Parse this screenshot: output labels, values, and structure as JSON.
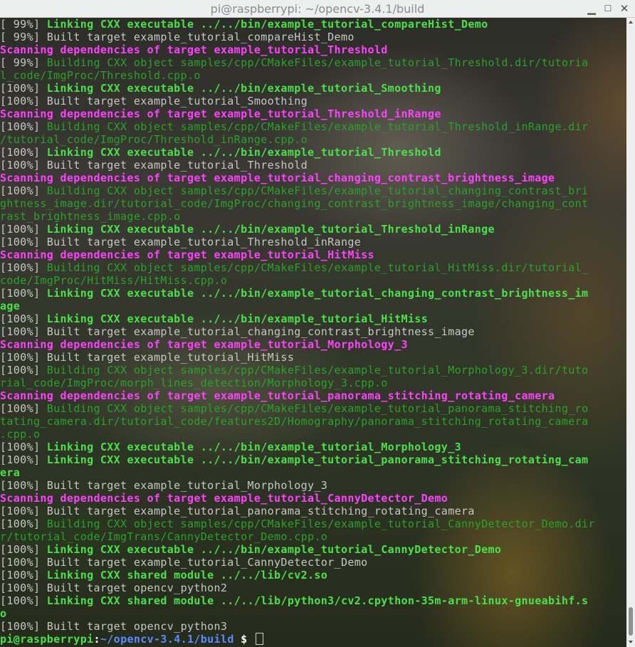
{
  "window": {
    "title": "pi@raspberrypi: ~/opencv-3.4.1/build",
    "minimize_glyph": "▁",
    "maximize_glyph": "☐",
    "close_glyph": "✕"
  },
  "colors": {
    "link_green": "#49e349",
    "build_green": "#27a427",
    "scan_magenta": "#ff40ff",
    "text_grey": "#c7c7c7",
    "prompt_path_blue": "#5a8cff"
  },
  "terminal": {
    "lines": [
      [
        {
          "c": "pct",
          "t": "[ 99%] "
        },
        {
          "c": "green",
          "t": "Linking CXX executable ../../bin/example_tutorial_compareHist_Demo"
        }
      ],
      [
        {
          "c": "pct",
          "t": "[ 99%] "
        },
        {
          "c": "grey",
          "t": "Built target example_tutorial_compareHist_Demo"
        }
      ],
      [
        {
          "c": "magenta",
          "t": "Scanning dependencies of target example_tutorial_Threshold"
        }
      ],
      [
        {
          "c": "pct",
          "t": "[ 99%] "
        },
        {
          "c": "dkgreen",
          "t": "Building CXX object samples/cpp/CMakeFiles/example_tutorial_Threshold.dir/tutoria"
        }
      ],
      [
        {
          "c": "dkgreen",
          "t": "l_code/ImgProc/Threshold.cpp.o"
        }
      ],
      [
        {
          "c": "pct",
          "t": "[100%] "
        },
        {
          "c": "green",
          "t": "Linking CXX executable ../../bin/example_tutorial_Smoothing"
        }
      ],
      [
        {
          "c": "pct",
          "t": "[100%] "
        },
        {
          "c": "grey",
          "t": "Built target example_tutorial_Smoothing"
        }
      ],
      [
        {
          "c": "magenta",
          "t": "Scanning dependencies of target example_tutorial_Threshold_inRange"
        }
      ],
      [
        {
          "c": "pct",
          "t": "[100%] "
        },
        {
          "c": "dkgreen",
          "t": "Building CXX object samples/cpp/CMakeFiles/example_tutorial_Threshold_inRange.dir"
        }
      ],
      [
        {
          "c": "dkgreen",
          "t": "/tutorial_code/ImgProc/Threshold_inRange.cpp.o"
        }
      ],
      [
        {
          "c": "pct",
          "t": "[100%] "
        },
        {
          "c": "green",
          "t": "Linking CXX executable ../../bin/example_tutorial_Threshold"
        }
      ],
      [
        {
          "c": "pct",
          "t": "[100%] "
        },
        {
          "c": "grey",
          "t": "Built target example_tutorial_Threshold"
        }
      ],
      [
        {
          "c": "magenta",
          "t": "Scanning dependencies of target example_tutorial_changing_contrast_brightness_image"
        }
      ],
      [
        {
          "c": "pct",
          "t": "[100%] "
        },
        {
          "c": "dkgreen",
          "t": "Building CXX object samples/cpp/CMakeFiles/example_tutorial_changing_contrast_bri"
        }
      ],
      [
        {
          "c": "dkgreen",
          "t": "ghtness_image.dir/tutorial_code/ImgProc/changing_contrast_brightness_image/changing_cont"
        }
      ],
      [
        {
          "c": "dkgreen",
          "t": "rast_brightness_image.cpp.o"
        }
      ],
      [
        {
          "c": "pct",
          "t": "[100%] "
        },
        {
          "c": "green",
          "t": "Linking CXX executable ../../bin/example_tutorial_Threshold_inRange"
        }
      ],
      [
        {
          "c": "pct",
          "t": "[100%] "
        },
        {
          "c": "grey",
          "t": "Built target example_tutorial_Threshold_inRange"
        }
      ],
      [
        {
          "c": "magenta",
          "t": "Scanning dependencies of target example_tutorial_HitMiss"
        }
      ],
      [
        {
          "c": "pct",
          "t": "[100%] "
        },
        {
          "c": "dkgreen",
          "t": "Building CXX object samples/cpp/CMakeFiles/example_tutorial_HitMiss.dir/tutorial_"
        }
      ],
      [
        {
          "c": "dkgreen",
          "t": "code/ImgProc/HitMiss/HitMiss.cpp.o"
        }
      ],
      [
        {
          "c": "pct",
          "t": "[100%] "
        },
        {
          "c": "green",
          "t": "Linking CXX executable ../../bin/example_tutorial_changing_contrast_brightness_im"
        }
      ],
      [
        {
          "c": "green",
          "t": "age"
        }
      ],
      [
        {
          "c": "pct",
          "t": "[100%] "
        },
        {
          "c": "green",
          "t": "Linking CXX executable ../../bin/example_tutorial_HitMiss"
        }
      ],
      [
        {
          "c": "pct",
          "t": "[100%] "
        },
        {
          "c": "grey",
          "t": "Built target example_tutorial_changing_contrast_brightness_image"
        }
      ],
      [
        {
          "c": "magenta",
          "t": "Scanning dependencies of target example_tutorial_Morphology_3"
        }
      ],
      [
        {
          "c": "pct",
          "t": "[100%] "
        },
        {
          "c": "grey",
          "t": "Built target example_tutorial_HitMiss"
        }
      ],
      [
        {
          "c": "pct",
          "t": "[100%] "
        },
        {
          "c": "dkgreen",
          "t": "Building CXX object samples/cpp/CMakeFiles/example_tutorial_Morphology_3.dir/tuto"
        }
      ],
      [
        {
          "c": "dkgreen",
          "t": "rial_code/ImgProc/morph_lines_detection/Morphology_3.cpp.o"
        }
      ],
      [
        {
          "c": "magenta",
          "t": "Scanning dependencies of target example_tutorial_panorama_stitching_rotating_camera"
        }
      ],
      [
        {
          "c": "pct",
          "t": "[100%] "
        },
        {
          "c": "dkgreen",
          "t": "Building CXX object samples/cpp/CMakeFiles/example_tutorial_panorama_stitching_ro"
        }
      ],
      [
        {
          "c": "dkgreen",
          "t": "tating_camera.dir/tutorial_code/features2D/Homography/panorama_stitching_rotating_camera"
        }
      ],
      [
        {
          "c": "dkgreen",
          "t": ".cpp.o"
        }
      ],
      [
        {
          "c": "pct",
          "t": "[100%] "
        },
        {
          "c": "green",
          "t": "Linking CXX executable ../../bin/example_tutorial_Morphology_3"
        }
      ],
      [
        {
          "c": "pct",
          "t": "[100%] "
        },
        {
          "c": "green",
          "t": "Linking CXX executable ../../bin/example_tutorial_panorama_stitching_rotating_cam"
        }
      ],
      [
        {
          "c": "green",
          "t": "era"
        }
      ],
      [
        {
          "c": "pct",
          "t": "[100%] "
        },
        {
          "c": "grey",
          "t": "Built target example_tutorial_Morphology_3"
        }
      ],
      [
        {
          "c": "magenta",
          "t": "Scanning dependencies of target example_tutorial_CannyDetector_Demo"
        }
      ],
      [
        {
          "c": "pct",
          "t": "[100%] "
        },
        {
          "c": "grey",
          "t": "Built target example_tutorial_panorama_stitching_rotating_camera"
        }
      ],
      [
        {
          "c": "pct",
          "t": "[100%] "
        },
        {
          "c": "dkgreen",
          "t": "Building CXX object samples/cpp/CMakeFiles/example_tutorial_CannyDetector_Demo.dir"
        }
      ],
      [
        {
          "c": "dkgreen",
          "t": "r/tutorial_code/ImgTrans/CannyDetector_Demo.cpp.o"
        }
      ],
      [
        {
          "c": "pct",
          "t": "[100%] "
        },
        {
          "c": "green",
          "t": "Linking CXX executable ../../bin/example_tutorial_CannyDetector_Demo"
        }
      ],
      [
        {
          "c": "pct",
          "t": "[100%] "
        },
        {
          "c": "grey",
          "t": "Built target example_tutorial_CannyDetector_Demo"
        }
      ],
      [
        {
          "c": "pct",
          "t": "[100%] "
        },
        {
          "c": "green",
          "t": "Linking CXX shared module ../../lib/cv2.so"
        }
      ],
      [
        {
          "c": "pct",
          "t": "[100%] "
        },
        {
          "c": "grey",
          "t": "Built target opencv_python2"
        }
      ],
      [
        {
          "c": "pct",
          "t": "[100%] "
        },
        {
          "c": "green",
          "t": "Linking CXX shared module ../../lib/python3/cv2.cpython-35m-arm-linux-gnueabihf.s"
        }
      ],
      [
        {
          "c": "green",
          "t": "o"
        }
      ],
      [
        {
          "c": "pct",
          "t": "[100%] "
        },
        {
          "c": "grey",
          "t": "Built target opencv_python3"
        }
      ]
    ],
    "prompt": {
      "user_host": "pi@raspberrypi",
      "separator": ":",
      "path": "~/opencv-3.4.1/build",
      "symbol": " $ "
    }
  }
}
